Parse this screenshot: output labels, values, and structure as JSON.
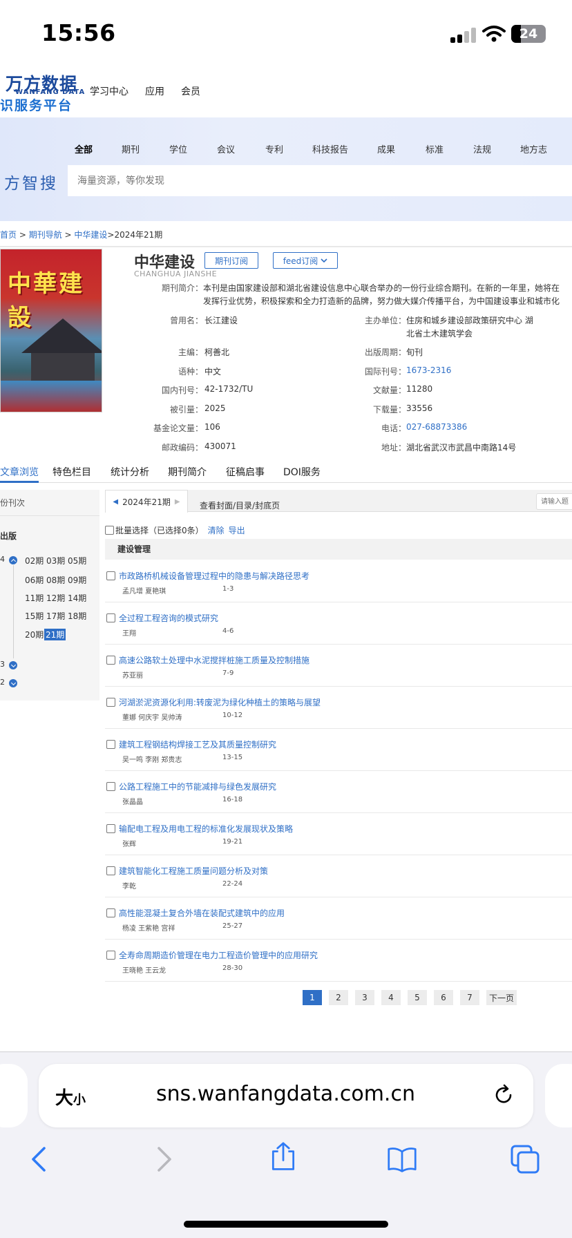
{
  "status": {
    "time": "15:56",
    "battery": "24"
  },
  "header": {
    "logo_top": "万方数据",
    "logo_sub": "WANFANG DATA",
    "logo_bottom": "识服务平台",
    "nav": [
      "学习中心",
      "应用",
      "会员"
    ]
  },
  "search": {
    "categories": [
      "全部",
      "期刊",
      "学位",
      "会议",
      "专利",
      "科技报告",
      "成果",
      "标准",
      "法规",
      "地方志"
    ],
    "brand": "方智搜",
    "placeholder": "海量资源，等你发现"
  },
  "breadcrumb": {
    "home": "首页",
    "sep": " > ",
    "journal_nav": "期刊导航",
    "journal": "中华建设",
    "current": ">2024年21期"
  },
  "journal": {
    "title": "中华建设",
    "pinyin": "CHANGHUA JIANSHE",
    "cover_text": "中華建設",
    "subscribe_label": "期刊订阅",
    "feed_label": "feed订阅",
    "intro_label": "期刊简介：",
    "intro_line1": "本刊是由国家建设部和湖北省建设信息中心联合举办的一份行业综合期刊。在新的一年里，她将在",
    "intro_line2": "发挥行业优势，积极探索和全力打造新的品牌，努力做大媒介传播平台，为中国建设事业和城市化",
    "left_fields": [
      {
        "label": "曾用名：",
        "value": "长江建设"
      },
      {
        "label": "主编：",
        "value": "柯善北"
      },
      {
        "label": "语种：",
        "value": "中文"
      },
      {
        "label": "国内刊号：",
        "value": "42-1732/TU"
      },
      {
        "label": "被引量：",
        "value": "2025"
      },
      {
        "label": "基金论文量：",
        "value": "106"
      },
      {
        "label": "邮政编码：",
        "value": "430071"
      }
    ],
    "right_fields": [
      {
        "label": "主办单位：",
        "value": "住房和城乡建设部政策研究中心 湖",
        "value2": "北省土木建筑学会"
      },
      {
        "label": "出版周期：",
        "value": "旬刊"
      },
      {
        "label": "国际刊号：",
        "value": "1673-2316"
      },
      {
        "label": "文献量：",
        "value": "11280"
      },
      {
        "label": "下载量：",
        "value": "33556"
      },
      {
        "label": "电话：",
        "value": "027-68873386"
      },
      {
        "label": "地址：",
        "value": "湖北省武汉市武昌中南路14号"
      }
    ]
  },
  "tabs": [
    "文章浏览",
    "特色栏目",
    "统计分析",
    "期刊简介",
    "征稿启事",
    "DOI服务"
  ],
  "side": {
    "title": "份刊次",
    "subtitle": "出版",
    "years": [
      "4",
      "3",
      "2"
    ],
    "issues": [
      "02期",
      "03期",
      "05期",
      "06期",
      "08期",
      "09期",
      "11期",
      "12期",
      "14期",
      "15期",
      "17期",
      "18期",
      "20期",
      "21期"
    ],
    "active_issue": "21期"
  },
  "list": {
    "issue_tab": "2024年21期",
    "toc_link": "查看封面/目录/封底页",
    "search_placeholder": "请输入题",
    "bulk_label": "批量选择（已选择0条）",
    "clear": "清除",
    "export": "导出",
    "section": "建设管理",
    "articles": [
      {
        "title": "市政路桥机械设备管理过程中的隐患与解决路径思考",
        "authors": "孟凡增 夏艳琪",
        "pages": "1-3"
      },
      {
        "title": "全过程工程咨询的模式研究",
        "authors": "王翔",
        "pages": "4-6"
      },
      {
        "title": "高速公路软土处理中水泥搅拌桩施工质量及控制措施",
        "authors": "苏亚丽",
        "pages": "7-9"
      },
      {
        "title": "河湖淤泥资源化利用:转废泥为绿化种植土的策略与展望",
        "authors": "董娜 何庆宇 吴帅涛",
        "pages": "10-12"
      },
      {
        "title": "建筑工程钢结构焊接工艺及其质量控制研究",
        "authors": "吴一鸣 李刚 郑贵志",
        "pages": "13-15"
      },
      {
        "title": "公路工程施工中的节能减排与绿色发展研究",
        "authors": "张晶晶",
        "pages": "16-18"
      },
      {
        "title": "输配电工程及用电工程的标准化发展现状及策略",
        "authors": "张辉",
        "pages": "19-21"
      },
      {
        "title": "建筑智能化工程施工质量问题分析及对策",
        "authors": "李乾",
        "pages": "22-24"
      },
      {
        "title": "高性能混凝土复合外墙在装配式建筑中的应用",
        "authors": "杨凌 王紫艳 宫祥",
        "pages": "25-27"
      },
      {
        "title": "全寿命周期造价管理在电力工程造价管理中的应用研究",
        "authors": "王晓艳 王云龙",
        "pages": "28-30"
      }
    ],
    "pages": [
      "1",
      "2",
      "3",
      "4",
      "5",
      "6",
      "7"
    ],
    "next": "下一页"
  },
  "browser": {
    "aa_big": "大",
    "aa_small": "小",
    "url": "sns.wanfangdata.com.cn"
  },
  "colors": {
    "accent": "#2f6fc6",
    "brand": "#1c4a9c"
  }
}
